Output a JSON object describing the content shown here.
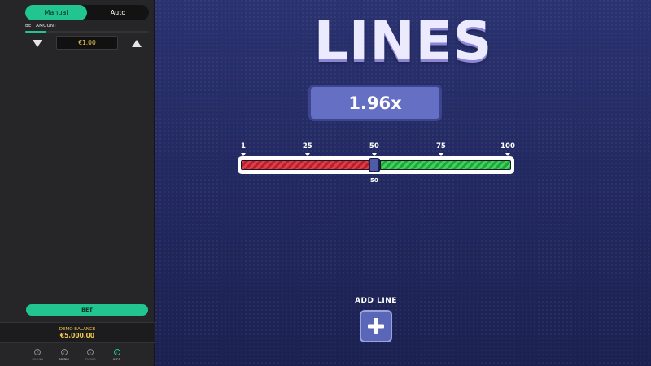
{
  "sidebar": {
    "mode_tabs": [
      {
        "label": "Manual",
        "active": true
      },
      {
        "label": "Auto",
        "active": false
      }
    ],
    "bet_label": "BET AMOUNT",
    "bet_amount": "€1.00",
    "bet_button_label": "BET",
    "balance_label": "DEMO BALANCE",
    "balance_value": "€5,000.00",
    "footer_nav": [
      {
        "label": "SOUND",
        "icon": "sound-icon"
      },
      {
        "label": "MUSIC",
        "icon": "music-icon"
      },
      {
        "label": "TURBO",
        "icon": "turbo-icon"
      },
      {
        "label": "INFO",
        "icon": "info-icon",
        "active": true
      }
    ]
  },
  "game": {
    "title": "LINES",
    "multiplier": "1.96x",
    "slider": {
      "min": 1,
      "max": 100,
      "value": 50,
      "value_label": "50",
      "ticks": [
        {
          "value": 1,
          "label": "1"
        },
        {
          "value": 25,
          "label": "25"
        },
        {
          "value": 50,
          "label": "50"
        },
        {
          "value": 75,
          "label": "75"
        },
        {
          "value": 100,
          "label": "100"
        }
      ]
    },
    "add_line_label": "ADD LINE"
  },
  "colors": {
    "accent": "#22c48f",
    "gold": "#f2c94c",
    "lose_red": "#e23b4a",
    "win_green": "#3fd35b",
    "game_bg": "#232a62"
  }
}
